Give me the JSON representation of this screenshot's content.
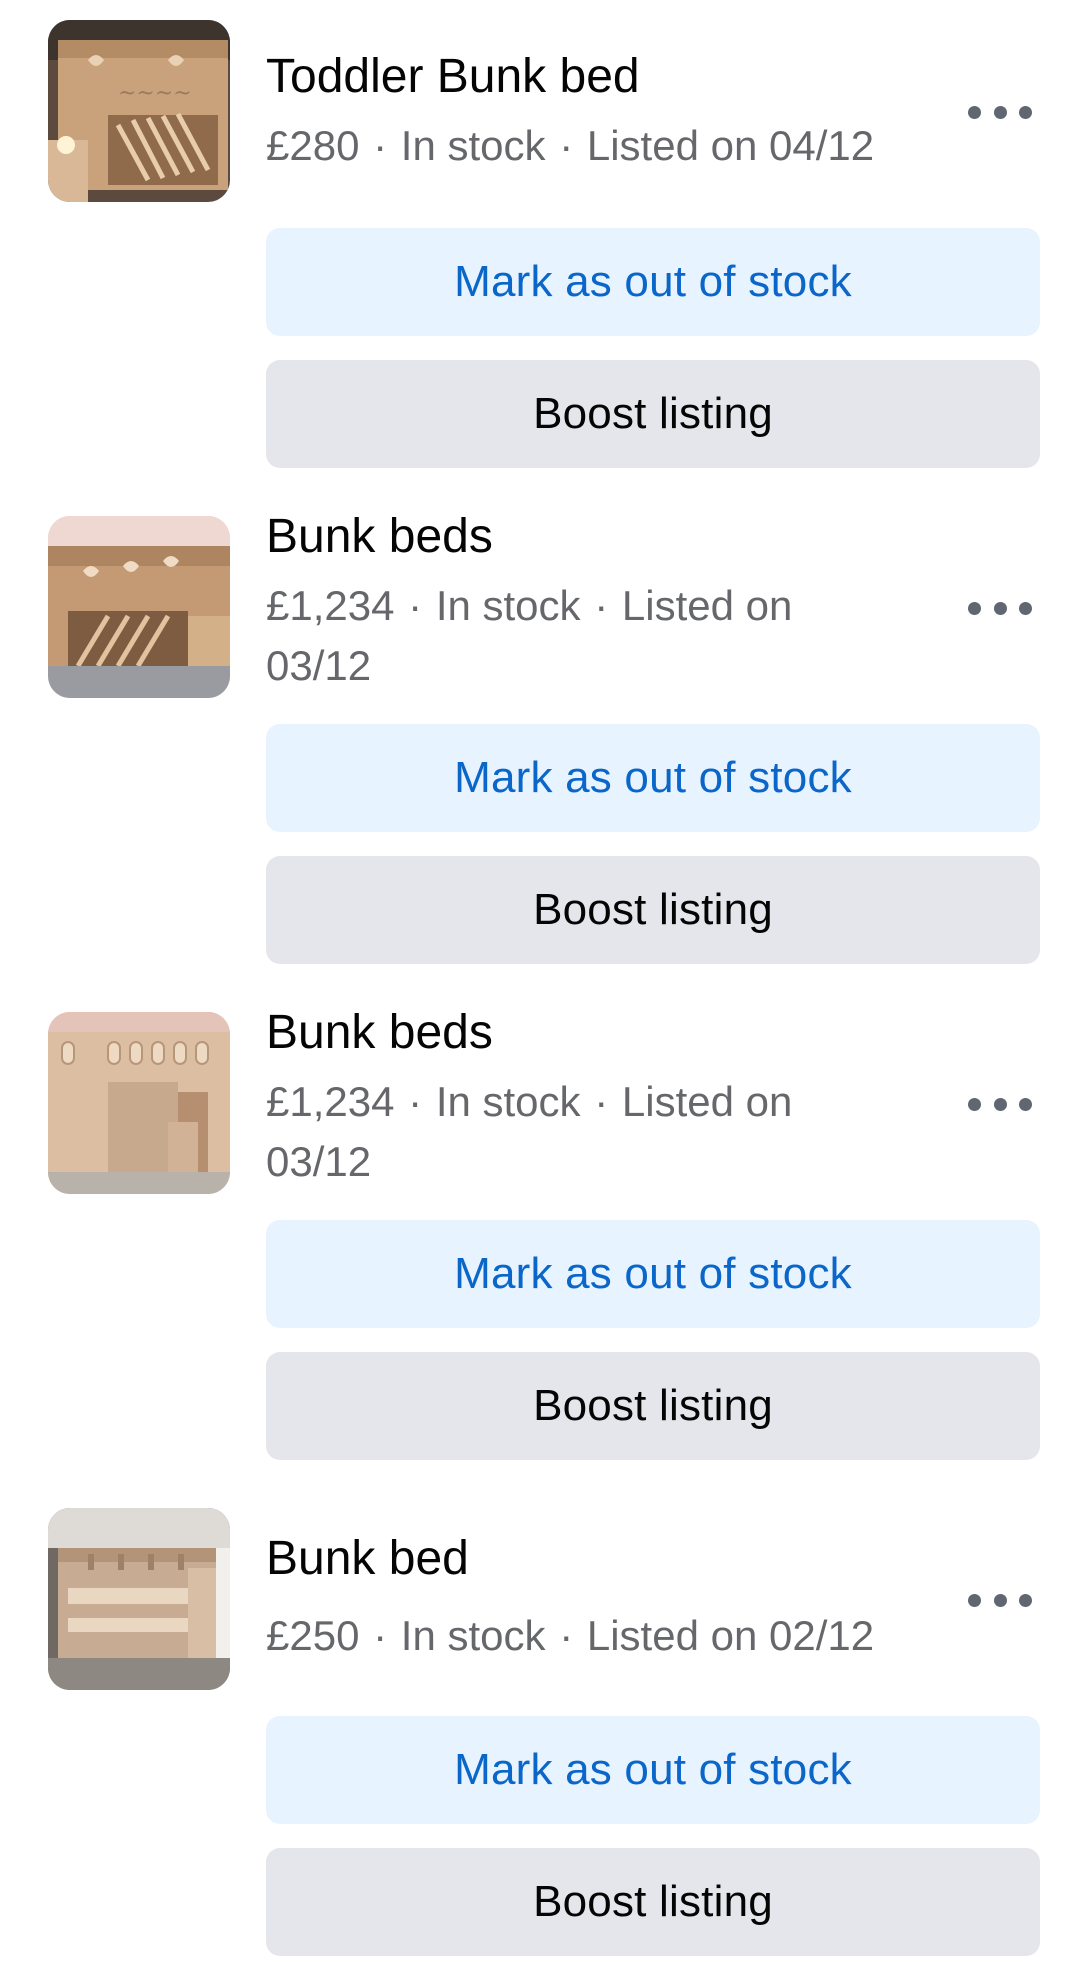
{
  "listings": [
    {
      "title": "Toddler Bunk bed",
      "price": "£280",
      "stock": "In stock",
      "listed": "Listed on 04/12",
      "more_icon": "more-horizontal-icon",
      "mark_label": "Mark as out of stock",
      "boost_label": "Boost listing"
    },
    {
      "title": "Bunk beds",
      "price": "£1,234",
      "stock": "In stock",
      "listed": "Listed on 03/12",
      "more_icon": "more-horizontal-icon",
      "mark_label": "Mark as out of stock",
      "boost_label": "Boost listing"
    },
    {
      "title": "Bunk beds",
      "price": "£1,234",
      "stock": "In stock",
      "listed": "Listed on 03/12",
      "more_icon": "more-horizontal-icon",
      "mark_label": "Mark as out of stock",
      "boost_label": "Boost listing"
    },
    {
      "title": "Bunk bed",
      "price": "£250",
      "stock": "In stock",
      "listed": "Listed on 02/12",
      "more_icon": "more-horizontal-icon",
      "mark_label": "Mark as out of stock",
      "boost_label": "Boost listing"
    }
  ],
  "separator": "·",
  "colors": {
    "primary_button_bg": "#e7f3ff",
    "primary_button_text": "#0a66c9",
    "secondary_button_bg": "#e4e6eb",
    "meta_text": "#65676b"
  }
}
